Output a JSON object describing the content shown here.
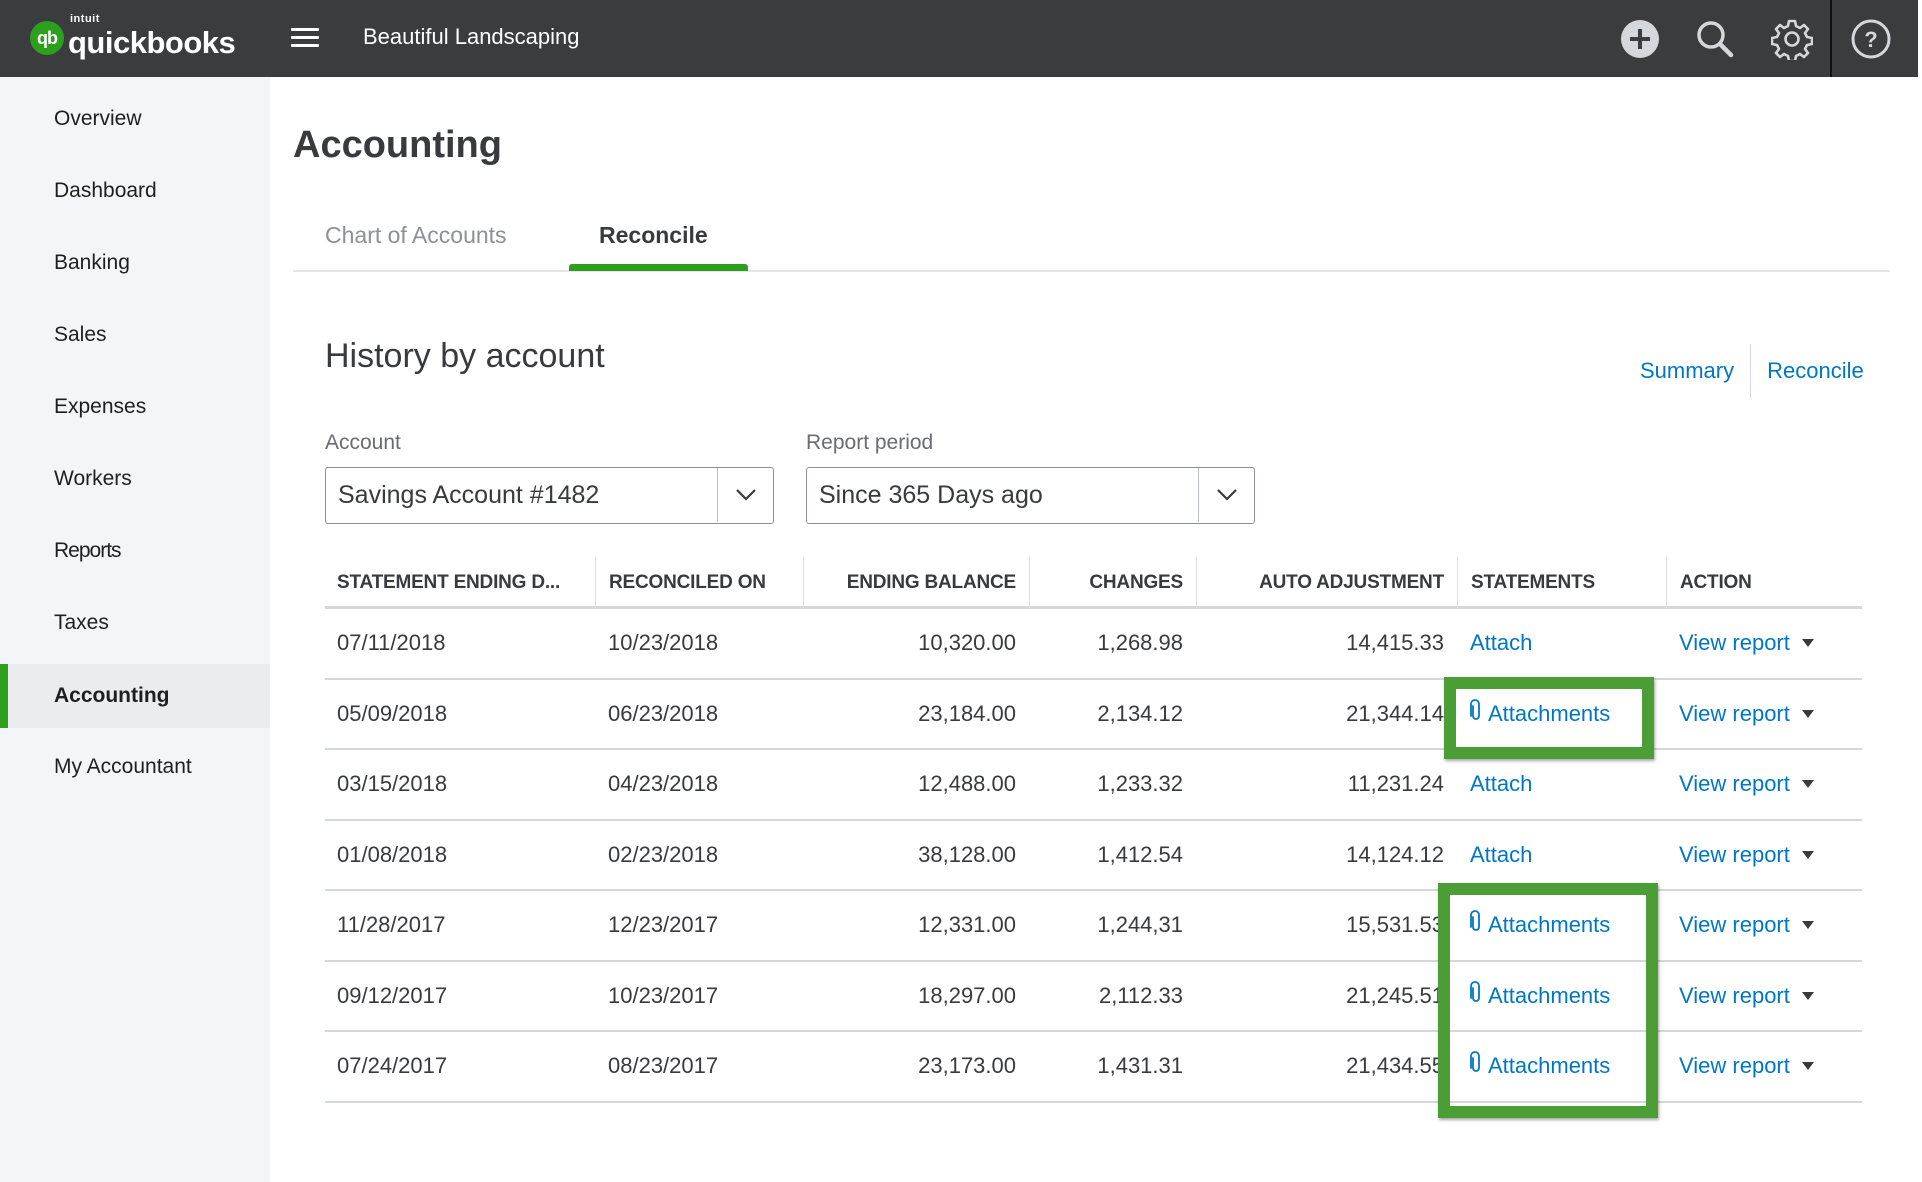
{
  "header": {
    "logo_brand": "intuit",
    "logo_product": "quickbooks",
    "logo_badge": "qb",
    "company_name": "Beautiful Landscaping",
    "icons": [
      "plus-circle-icon",
      "search-icon",
      "gear-icon",
      "help-icon"
    ]
  },
  "sidebar": {
    "items": [
      {
        "label": "Overview",
        "active": false
      },
      {
        "label": "Dashboard",
        "active": false
      },
      {
        "label": "Banking",
        "active": false
      },
      {
        "label": "Sales",
        "active": false
      },
      {
        "label": "Expenses",
        "active": false
      },
      {
        "label": "Workers",
        "active": false
      },
      {
        "label": "Reports",
        "active": false
      },
      {
        "label": "Taxes",
        "active": false
      },
      {
        "label": "Accounting",
        "active": true
      },
      {
        "label": "My Accountant",
        "active": false
      }
    ]
  },
  "page": {
    "title": "Accounting",
    "tabs": [
      {
        "label": "Chart of Accounts",
        "active": false
      },
      {
        "label": "Reconcile",
        "active": true
      }
    ],
    "section_title": "History by account",
    "links": {
      "summary": "Summary",
      "reconcile": "Reconcile"
    }
  },
  "filters": {
    "account": {
      "label": "Account",
      "value": "Savings Account #1482"
    },
    "period": {
      "label": "Report period",
      "value": "Since 365 Days ago"
    }
  },
  "table": {
    "columns": [
      "STATEMENT ENDING D...",
      "RECONCILED ON",
      "ENDING BALANCE",
      "CHANGES",
      "AUTO ADJUSTMENT",
      "STATEMENTS",
      "ACTION"
    ],
    "rows": [
      {
        "statement_end": "07/11/2018",
        "reconciled_on": "10/23/2018",
        "ending_balance": "10,320.00",
        "changes": "1,268.98",
        "auto_adjustment": "14,415.33",
        "statements": "Attach",
        "has_attachments": false,
        "action": "View report"
      },
      {
        "statement_end": "05/09/2018",
        "reconciled_on": "06/23/2018",
        "ending_balance": "23,184.00",
        "changes": "2,134.12",
        "auto_adjustment": "21,344.14",
        "statements": "Attachments",
        "has_attachments": true,
        "action": "View report"
      },
      {
        "statement_end": "03/15/2018",
        "reconciled_on": "04/23/2018",
        "ending_balance": "12,488.00",
        "changes": "1,233.32",
        "auto_adjustment": "11,231.24",
        "statements": "Attach",
        "has_attachments": false,
        "action": "View report"
      },
      {
        "statement_end": "01/08/2018",
        "reconciled_on": "02/23/2018",
        "ending_balance": "38,128.00",
        "changes": "1,412.54",
        "auto_adjustment": "14,124.12",
        "statements": "Attach",
        "has_attachments": false,
        "action": "View report"
      },
      {
        "statement_end": "11/28/2017",
        "reconciled_on": "12/23/2017",
        "ending_balance": "12,331.00",
        "changes": "1,244,31",
        "auto_adjustment": "15,531.53",
        "statements": "Attachments",
        "has_attachments": true,
        "action": "View report"
      },
      {
        "statement_end": "09/12/2017",
        "reconciled_on": "10/23/2017",
        "ending_balance": "18,297.00",
        "changes": "2,112.33",
        "auto_adjustment": "21,245.51",
        "statements": "Attachments",
        "has_attachments": true,
        "action": "View report"
      },
      {
        "statement_end": "07/24/2017",
        "reconciled_on": "08/23/2017",
        "ending_balance": "23,173.00",
        "changes": "1,431.31",
        "auto_adjustment": "21,434.55",
        "statements": "Attachments",
        "has_attachments": true,
        "action": "View report"
      }
    ]
  },
  "colors": {
    "brand_green": "#2ca01c",
    "link_blue": "#0077c5",
    "header_bg": "#3b3c3e",
    "highlight_green": "#4a9e35"
  }
}
